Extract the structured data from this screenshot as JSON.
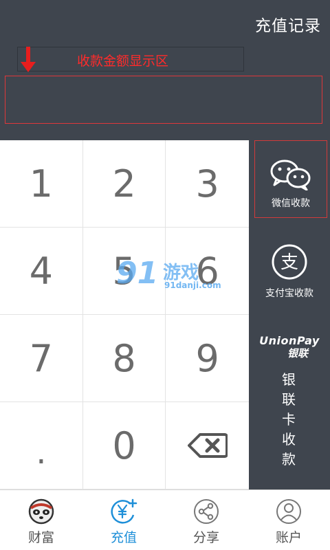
{
  "header": {
    "records_label": "充值记录",
    "hint_label": "收款金额显示区"
  },
  "keypad": {
    "keys": [
      "1",
      "2",
      "3",
      "4",
      "5",
      "6",
      "7",
      "8",
      "9",
      ".",
      "0"
    ],
    "backspace_icon": "backspace-icon"
  },
  "payment": {
    "wechat_label": "微信收款",
    "alipay_label": "支付宝收款",
    "alipay_glyph": "支",
    "union_logo_en": "UnionPay",
    "union_logo_cn": "银联",
    "union_label": [
      "银",
      "联",
      "卡",
      "收",
      "款"
    ]
  },
  "watermark": {
    "num": "91",
    "cn": "游戏",
    "url": "91danji.com"
  },
  "tabs": [
    {
      "label": "财富",
      "icon": "panda-avatar-icon"
    },
    {
      "label": "充值",
      "icon": "yen-plus-icon"
    },
    {
      "label": "分享",
      "icon": "share-icon"
    },
    {
      "label": "账户",
      "icon": "user-icon"
    }
  ],
  "colors": {
    "background": "#3f454e",
    "accent": "#1e8fd8",
    "hint_red": "#ff2b2b",
    "keypad_text": "#6b6b6b"
  }
}
